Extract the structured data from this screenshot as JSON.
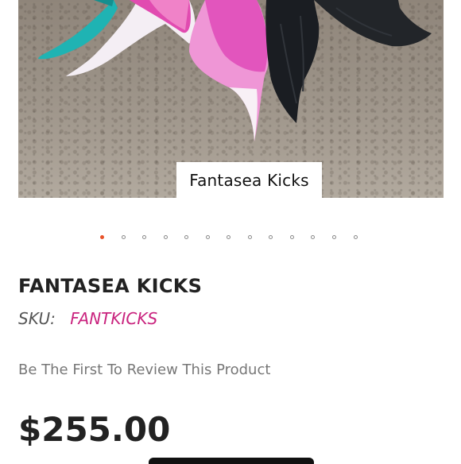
{
  "gallery": {
    "caption": "Fantasea Kicks",
    "slide_count": 13,
    "active_index": 0,
    "image_subject": "mermaid-fins"
  },
  "product": {
    "title": "FANTASEA KICKS",
    "sku_label": "SKU:",
    "sku_value": "FANTKICKS",
    "review_link": "Be The First To Review This Product",
    "price": "$255.00"
  },
  "colors": {
    "accent_dot": "#e8532a",
    "sku_value": "#c9237e"
  }
}
